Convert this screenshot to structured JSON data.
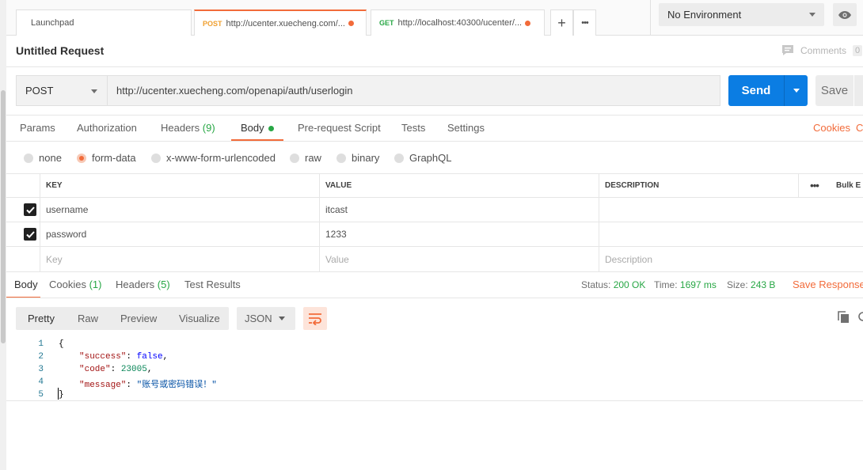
{
  "tabs": {
    "launchpad": "Launchpad",
    "tab1_method": "POST",
    "tab1_url": "http://ucenter.xuecheng.com/...",
    "tab2_method": "GET",
    "tab2_url": "http://localhost:40300/ucenter/...",
    "add": "+",
    "more": "•••"
  },
  "environment": {
    "selected": "No Environment"
  },
  "request": {
    "name": "Untitled Request",
    "comments_label": "Comments",
    "comments_count": "0",
    "method": "POST",
    "url": "http://ucenter.xuecheng.com/openapi/auth/userlogin",
    "send_label": "Send",
    "save_label": "Save"
  },
  "request_tabs": {
    "params": "Params",
    "authorization": "Authorization",
    "headers": "Headers",
    "headers_count": "(9)",
    "body": "Body",
    "prerequest": "Pre-request Script",
    "tests": "Tests",
    "settings": "Settings",
    "cookies": "Cookies",
    "code": "Co"
  },
  "body_types": [
    "none",
    "form-data",
    "x-www-form-urlencoded",
    "raw",
    "binary",
    "GraphQL"
  ],
  "body_type_selected": "form-data",
  "form_table": {
    "headers": {
      "key": "KEY",
      "value": "VALUE",
      "description": "DESCRIPTION",
      "more": "•••",
      "bulk": "Bulk E"
    },
    "rows": [
      {
        "key": "username",
        "value": "itcast",
        "checked": true
      },
      {
        "key": "password",
        "value": "1233",
        "checked": true
      }
    ],
    "placeholders": {
      "key": "Key",
      "value": "Value",
      "description": "Description"
    }
  },
  "response_tabs": {
    "body": "Body",
    "cookies": "Cookies",
    "cookies_count": "(1)",
    "headers": "Headers",
    "headers_count": "(5)",
    "tests": "Test Results"
  },
  "response_status": {
    "status_label": "Status:",
    "status_value": "200 OK",
    "time_label": "Time:",
    "time_value": "1697 ms",
    "size_label": "Size:",
    "size_value": "243 B",
    "save_response": "Save Response"
  },
  "format_buttons": [
    "Pretty",
    "Raw",
    "Preview",
    "Visualize"
  ],
  "format_selected": "JSON",
  "response_body": {
    "line_numbers": [
      "1",
      "2",
      "3",
      "4",
      "5"
    ],
    "open": "{",
    "k_success": "\"success\"",
    "v_success": "false",
    "k_code": "\"code\"",
    "v_code": "23005",
    "k_message": "\"message\"",
    "v_message": "\"账号或密码错误！\"",
    "close": "}"
  },
  "colors": {
    "accent": "#f26b3a",
    "send": "#0b7de3",
    "success": "#28a745"
  }
}
